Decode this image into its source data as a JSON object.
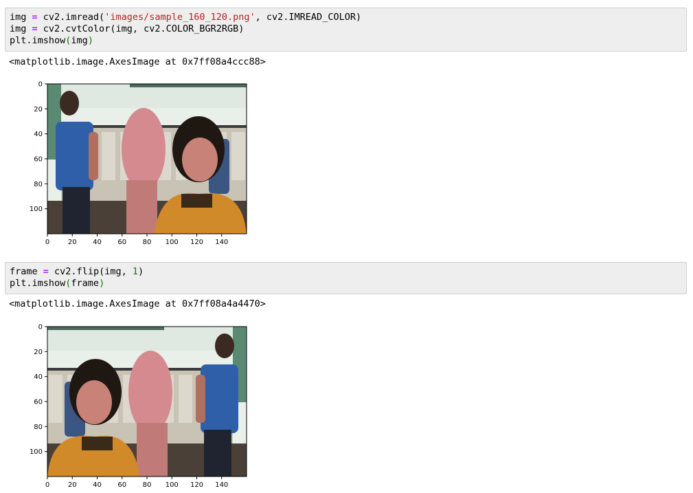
{
  "cells": [
    {
      "input_lines": [
        [
          {
            "t": "img "
          },
          {
            "t": "=",
            "c": "kw-eq"
          },
          {
            "t": " cv2.imread("
          },
          {
            "t": "'images/sample_160_120.png'",
            "c": "str"
          },
          {
            "t": ", cv2.IMREAD_COLOR)"
          }
        ],
        [
          {
            "t": "img "
          },
          {
            "t": "=",
            "c": "kw-eq"
          },
          {
            "t": " cv2.cvtColor(img, cv2.COLOR_BGR2RGB)"
          }
        ],
        [
          {
            "t": "plt.imshow"
          },
          {
            "t": "(",
            "c": "paren"
          },
          {
            "t": "img"
          },
          {
            "t": ")",
            "c": "paren"
          }
        ]
      ],
      "output_text": "<matplotlib.image.AxesImage at 0x7ff08a4ccc88>",
      "image": {
        "description": "webcam frame: man in blue shirt at left, woman raising hand",
        "flipped": false
      }
    },
    {
      "input_lines": [
        [
          {
            "t": "frame "
          },
          {
            "t": "=",
            "c": "kw-eq"
          },
          {
            "t": " cv2.flip(img, "
          },
          {
            "t": "1",
            "c": "num"
          },
          {
            "t": ")"
          }
        ],
        [
          {
            "t": "plt.imshow"
          },
          {
            "t": "(",
            "c": "paren"
          },
          {
            "t": "frame"
          },
          {
            "t": ")",
            "c": "paren"
          }
        ]
      ],
      "output_text": "<matplotlib.image.AxesImage at 0x7ff08a4a4470>",
      "image": {
        "description": "horizontally flipped webcam frame",
        "flipped": true
      }
    }
  ],
  "axes": {
    "x_ticks": [
      "0",
      "20",
      "40",
      "60",
      "80",
      "100",
      "120",
      "140"
    ],
    "y_ticks": [
      "0",
      "20",
      "40",
      "60",
      "80",
      "100"
    ],
    "x_values": [
      0,
      20,
      40,
      60,
      80,
      100,
      120,
      140
    ],
    "y_values": [
      0,
      20,
      40,
      60,
      80,
      100
    ],
    "xlim": [
      0,
      160
    ],
    "ylim": [
      120,
      0
    ]
  }
}
